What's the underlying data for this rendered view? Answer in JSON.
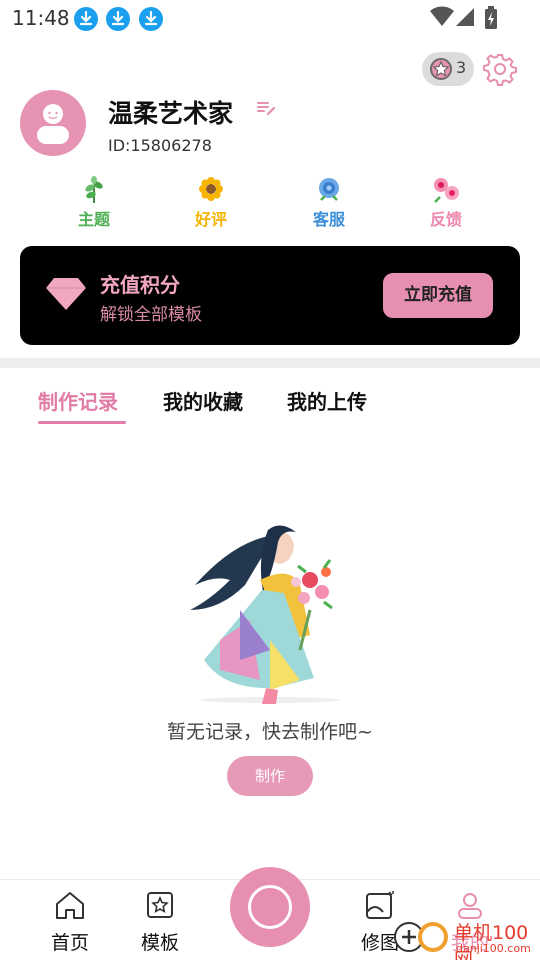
{
  "status_bar": {
    "time": "11:48"
  },
  "profile": {
    "username": "温柔艺术家",
    "id_text": "ID:15806278",
    "star_count": "3"
  },
  "quick_actions": [
    {
      "label": "主题",
      "color": "#4caf50",
      "icon": "leaf-icon"
    },
    {
      "label": "好评",
      "color": "#f5b400",
      "icon": "sunflower-icon"
    },
    {
      "label": "客服",
      "color": "#3a8fd6",
      "icon": "blue-flower-icon"
    },
    {
      "label": "反馈",
      "color": "#ef86ad",
      "icon": "pink-flower-icon"
    }
  ],
  "recharge": {
    "title": "充值积分",
    "subtitle": "解锁全部模板",
    "button": "立即充值"
  },
  "tabs": [
    {
      "label": "制作记录",
      "active": true
    },
    {
      "label": "我的收藏",
      "active": false
    },
    {
      "label": "我的上传",
      "active": false
    }
  ],
  "empty_state": {
    "text": "暂无记录，快去制作吧~",
    "button": "制作"
  },
  "bottom_nav": [
    {
      "label": "首页",
      "icon": "home-icon"
    },
    {
      "label": "模板",
      "icon": "star-frame-icon"
    },
    {
      "label": "",
      "icon": "create-icon"
    },
    {
      "label": "修图",
      "icon": "image-edit-icon"
    },
    {
      "label": "我的",
      "icon": "user-icon"
    }
  ],
  "watermark": {
    "text": "单机100网",
    "url": "danji100.com"
  },
  "colors": {
    "accent": "#e68fb0",
    "accent_text": "#e07ca5",
    "banner_bg": "#000000"
  }
}
